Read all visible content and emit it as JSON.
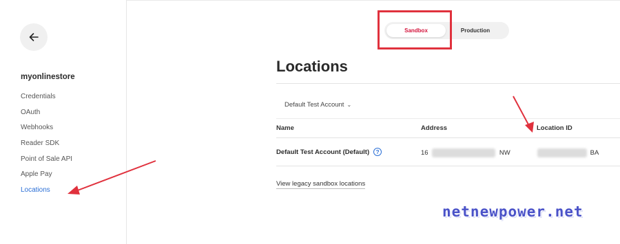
{
  "sidebar": {
    "app_name": "myonlinestore",
    "items": [
      {
        "label": "Credentials"
      },
      {
        "label": "OAuth"
      },
      {
        "label": "Webhooks"
      },
      {
        "label": "Reader SDK"
      },
      {
        "label": "Point of Sale API"
      },
      {
        "label": "Apple Pay"
      },
      {
        "label": "Locations"
      }
    ],
    "active_item": "Locations"
  },
  "environment": {
    "options": [
      "Sandbox",
      "Production"
    ],
    "selected": "Sandbox",
    "sandbox_color": "#d4143c"
  },
  "main": {
    "title": "Locations",
    "account_select": "Default Test Account",
    "table": {
      "headers": [
        "Name",
        "Address",
        "Location ID"
      ],
      "rows": [
        {
          "name": "Default Test Account (Default)",
          "address_prefix": "16",
          "address_suffix": "NW",
          "id_suffix": "BA"
        }
      ]
    },
    "legacy_link": "View legacy sandbox locations"
  },
  "watermark": "netnewpower.net",
  "colors": {
    "link_blue": "#2b6fd6",
    "annotation_red": "#e0313d"
  }
}
